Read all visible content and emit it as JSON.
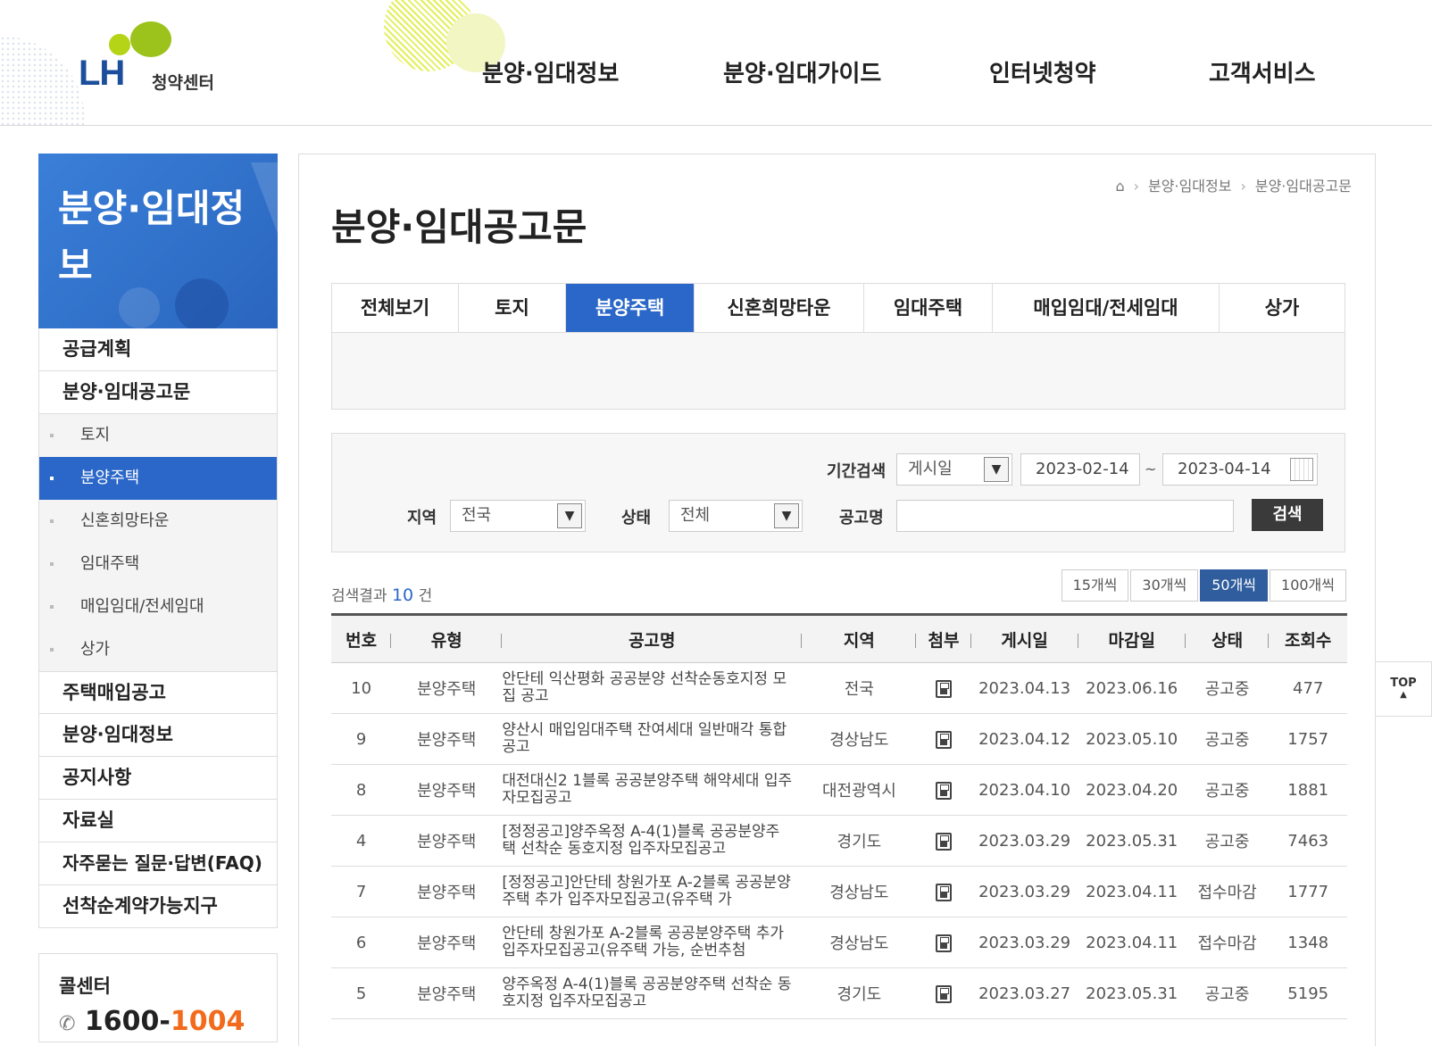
{
  "header": {
    "logo_mark": "LH",
    "logo_sub": "청약센터",
    "nav": [
      "분양·임대정보",
      "분양·임대가이드",
      "인터넷청약",
      "고객서비스"
    ]
  },
  "sidebar": {
    "title": "분양·임대정보",
    "items_top": [
      {
        "label": "공급계획"
      },
      {
        "label": "분양·임대공고문"
      }
    ],
    "sub_items": [
      {
        "label": "토지"
      },
      {
        "label": "분양주택"
      },
      {
        "label": "신혼희망타운"
      },
      {
        "label": "임대주택"
      },
      {
        "label": "매입임대/전세임대"
      },
      {
        "label": "상가"
      }
    ],
    "items_bottom": [
      {
        "label": "주택매입공고"
      },
      {
        "label": "분양·임대정보"
      },
      {
        "label": "공지사항"
      },
      {
        "label": "자료실"
      },
      {
        "label": "자주묻는 질문·답변(FAQ)"
      },
      {
        "label": "선착순계약가능지구"
      }
    ],
    "call_title": "콜센터",
    "call_prefix": "1600-",
    "call_suffix": "1004"
  },
  "main": {
    "breadcrumb": [
      "분양·임대정보",
      "분양·임대공고문"
    ],
    "title": "분양·임대공고문",
    "tabs": [
      {
        "label": "전체보기"
      },
      {
        "label": "토지"
      },
      {
        "label": "분양주택"
      },
      {
        "label": "신혼희망타운"
      },
      {
        "label": "임대주택"
      },
      {
        "label": "매입임대/전세임대"
      },
      {
        "label": "상가"
      }
    ],
    "active_tab": "분양주택"
  },
  "search": {
    "period_label": "기간검색",
    "period_type": "게시일",
    "date_from": "2023-02-14",
    "date_to": "2023-04-14",
    "tilde": "~",
    "region_label": "지역",
    "region_value": "전국",
    "status_label": "상태",
    "status_value": "전체",
    "name_label": "공고명",
    "name_value": "",
    "search_button": "검색"
  },
  "results": {
    "prefix": "검색결과",
    "count": "10",
    "suffix": "건",
    "page_sizes": [
      "15개씩",
      "30개씩",
      "50개씩",
      "100개씩"
    ],
    "active_page_size": "50개씩"
  },
  "table": {
    "headers": [
      "번호",
      "유형",
      "공고명",
      "지역",
      "첨부",
      "게시일",
      "마감일",
      "상태",
      "조회수"
    ],
    "rows": [
      {
        "no": "10",
        "type": "분양주택",
        "title": "안단테 익산평화 공공분양 선착순동호지정 모집 공고",
        "region": "전국",
        "posted": "2023.04.13",
        "deadline": "2023.06.16",
        "status": "공고중",
        "views": "477"
      },
      {
        "no": "9",
        "type": "분양주택",
        "title": "양산시 매입임대주택 잔여세대 일반매각 통합공고",
        "region": "경상남도",
        "posted": "2023.04.12",
        "deadline": "2023.05.10",
        "status": "공고중",
        "views": "1757"
      },
      {
        "no": "8",
        "type": "분양주택",
        "title": "대전대신2 1블록 공공분양주택 해약세대 입주자모집공고",
        "region": "대전광역시",
        "posted": "2023.04.10",
        "deadline": "2023.04.20",
        "status": "공고중",
        "views": "1881"
      },
      {
        "no": "4",
        "type": "분양주택",
        "title": "[정정공고]양주옥정 A-4(1)블록 공공분양주택 선착순 동호지정 입주자모집공고",
        "region": "경기도",
        "posted": "2023.03.29",
        "deadline": "2023.05.31",
        "status": "공고중",
        "views": "7463"
      },
      {
        "no": "7",
        "type": "분양주택",
        "title": "[정정공고]안단테 창원가포 A-2블록 공공분양주택 추가 입주자모집공고(유주택 가",
        "region": "경상남도",
        "posted": "2023.03.29",
        "deadline": "2023.04.11",
        "status": "접수마감",
        "views": "1777"
      },
      {
        "no": "6",
        "type": "분양주택",
        "title": "안단테 창원가포 A-2블록 공공분양주택 추가 입주자모집공고(유주택 가능, 순번추첨",
        "region": "경상남도",
        "posted": "2023.03.29",
        "deadline": "2023.04.11",
        "status": "접수마감",
        "views": "1348"
      },
      {
        "no": "5",
        "type": "분양주택",
        "title": "양주옥정 A-4(1)블록 공공분양주택 선착순 동호지정 입주자모집공고",
        "region": "경기도",
        "posted": "2023.03.27",
        "deadline": "2023.05.31",
        "status": "공고중",
        "views": "5195"
      }
    ]
  },
  "top_button": "TOP",
  "colors": {
    "primary": "#2b67c8",
    "accent_orange": "#f26a1b",
    "logo_green": "#9bc31b",
    "logo_blue": "#1b4e9b"
  }
}
